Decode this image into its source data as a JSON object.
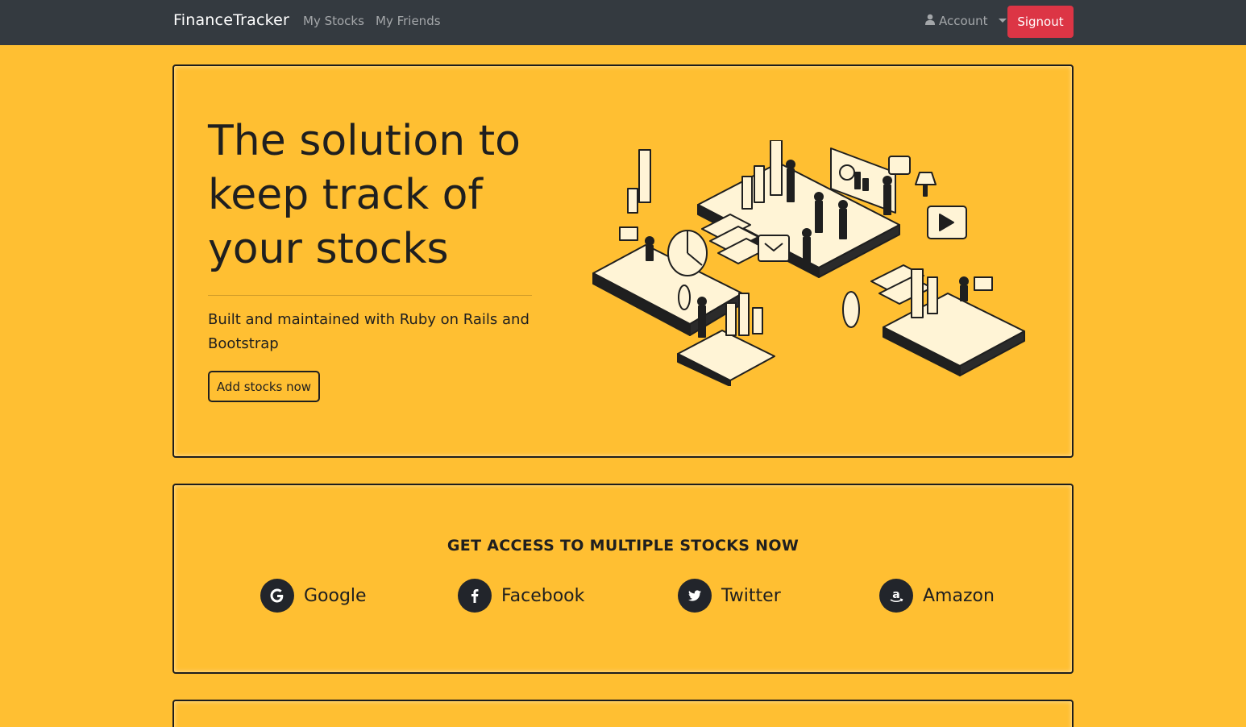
{
  "nav": {
    "brand": "FinanceTracker",
    "links": [
      "My Stocks",
      "My Friends"
    ],
    "account_label": "Account",
    "signout_label": "Signout"
  },
  "hero": {
    "title": "The solution to keep track of your stocks",
    "subtitle": "Built and maintained with Ruby on Rails and Bootstrap",
    "button_label": "Add stocks now"
  },
  "access": {
    "title": "GET ACCESS TO MULTIPLE STOCKS NOW",
    "brands": [
      {
        "label": "Google",
        "icon": "google-icon"
      },
      {
        "label": "Facebook",
        "icon": "facebook-icon"
      },
      {
        "label": "Twitter",
        "icon": "twitter-icon"
      },
      {
        "label": "Amazon",
        "icon": "amazon-icon"
      }
    ]
  },
  "colors": {
    "page_background": "#ffbf32",
    "navbar": "#343a40",
    "signout": "#dc3545",
    "icon_circle": "#22252b"
  }
}
